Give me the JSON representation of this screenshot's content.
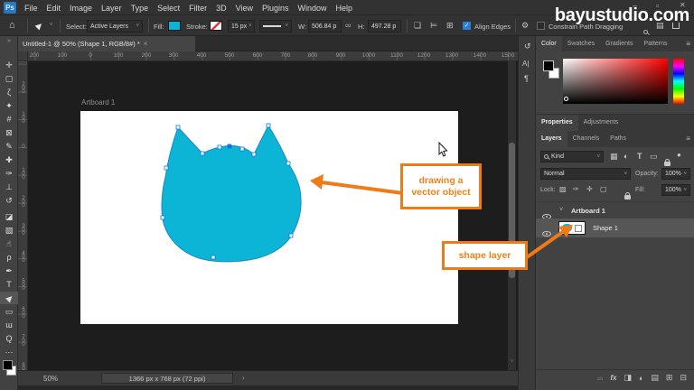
{
  "app": {
    "watermark": "bayustudio.com",
    "window_controls": {
      "minimize": "–",
      "maximize": "▫",
      "close": "✕"
    },
    "logo": "Ps"
  },
  "menubar": {
    "items": [
      "File",
      "Edit",
      "Image",
      "Layer",
      "Type",
      "Select",
      "Filter",
      "3D",
      "View",
      "Plugins",
      "Window",
      "Help"
    ]
  },
  "options": {
    "home": "⌂",
    "tool_arrow": "▶",
    "chev": "˅",
    "select_label": "Select:",
    "select_value": "Active Layers",
    "fill_label": "Fill:",
    "stroke_label": "Stroke:",
    "stroke_width": "15 px",
    "w_label": "W:",
    "w_value": "506.84 p",
    "link": "∞",
    "h_label": "H:",
    "h_value": "497.28 p",
    "ops_combine": "❏",
    "ops_align": "⊨",
    "ops_arrange": "⊞",
    "check": "✓",
    "align_edges": "Align Edges",
    "gear": "⚙",
    "constrain": "Constrain Path Dragging",
    "workspace": "▤"
  },
  "toolbar": {
    "expand": "»",
    "tool_glyphs": [
      "✛",
      "▢",
      "ζ",
      "✦",
      "#",
      "⊠",
      "✎",
      "✚",
      "✑",
      "⊥",
      "↺",
      "◪",
      "▧",
      "☝",
      "ρ",
      "✒",
      "T",
      "▶",
      "▭",
      "ɯ",
      "Q",
      "···"
    ]
  },
  "panel_strip": {
    "history": "↺",
    "character": "A|",
    "paragraph": "¶"
  },
  "color_panel": {
    "tabs": [
      "Color",
      "Swatches",
      "Gradients",
      "Patterns"
    ],
    "menu_icon": "≡"
  },
  "properties_panel": {
    "tabs": [
      "Properties",
      "Adjustments"
    ]
  },
  "layers_panel": {
    "tabs": [
      "Layers",
      "Channels",
      "Paths"
    ],
    "menu_icon": "≡",
    "filter_kind": "Kind",
    "filter_icons": [
      "▦",
      "◐",
      "T",
      "▭"
    ],
    "filter_dot": "●",
    "blend_mode": "Normal",
    "opacity_label": "Opacity:",
    "opacity_value": "100%",
    "lock_label": "Lock:",
    "lock_icons": [
      "▨",
      "✑",
      "✛",
      "▢"
    ],
    "fill_label": "Fill:",
    "fill_value": "100%",
    "artboard_row": {
      "chevron": "˅",
      "name": "Artboard 1"
    },
    "shape_row": {
      "name": "Shape 1"
    },
    "bottom_icons": {
      "link": "∞",
      "fx": "fx",
      "mask": "◨",
      "adjust": "◐",
      "group": "▤",
      "new": "⊞",
      "delete": "⊟"
    }
  },
  "document": {
    "tab_title": "Untitled-1 @ 50% (Shape 1, RGB/8#) *",
    "tab_close": "×",
    "artboard_label": "Artboard 1",
    "status_zoom": "50%",
    "status_dims": "1366 px x 768 px (72 ppi)",
    "status_chevron": "›"
  },
  "rulers": {
    "h": [
      "200",
      "100",
      "0",
      "100",
      "200",
      "300",
      "400",
      "500",
      "600",
      "700",
      "800",
      "900",
      "1000",
      "1100",
      "1200",
      "1300",
      "1400",
      "1500"
    ],
    "v": [
      "200",
      "100",
      "0",
      "100",
      "200",
      "300",
      "400",
      "500",
      "600",
      "700",
      "800",
      "900"
    ]
  },
  "annotations": {
    "label1_line1": "drawing a",
    "label1_line2": "vector object",
    "label2": "shape layer"
  },
  "colors": {
    "shape_fill": "#0cb4d6",
    "shape_stroke": "#1b89c9",
    "anchor_blue": "#1473e6",
    "annotation_orange": "#ee7b17",
    "ps_logo_blue": "#2579c4"
  }
}
